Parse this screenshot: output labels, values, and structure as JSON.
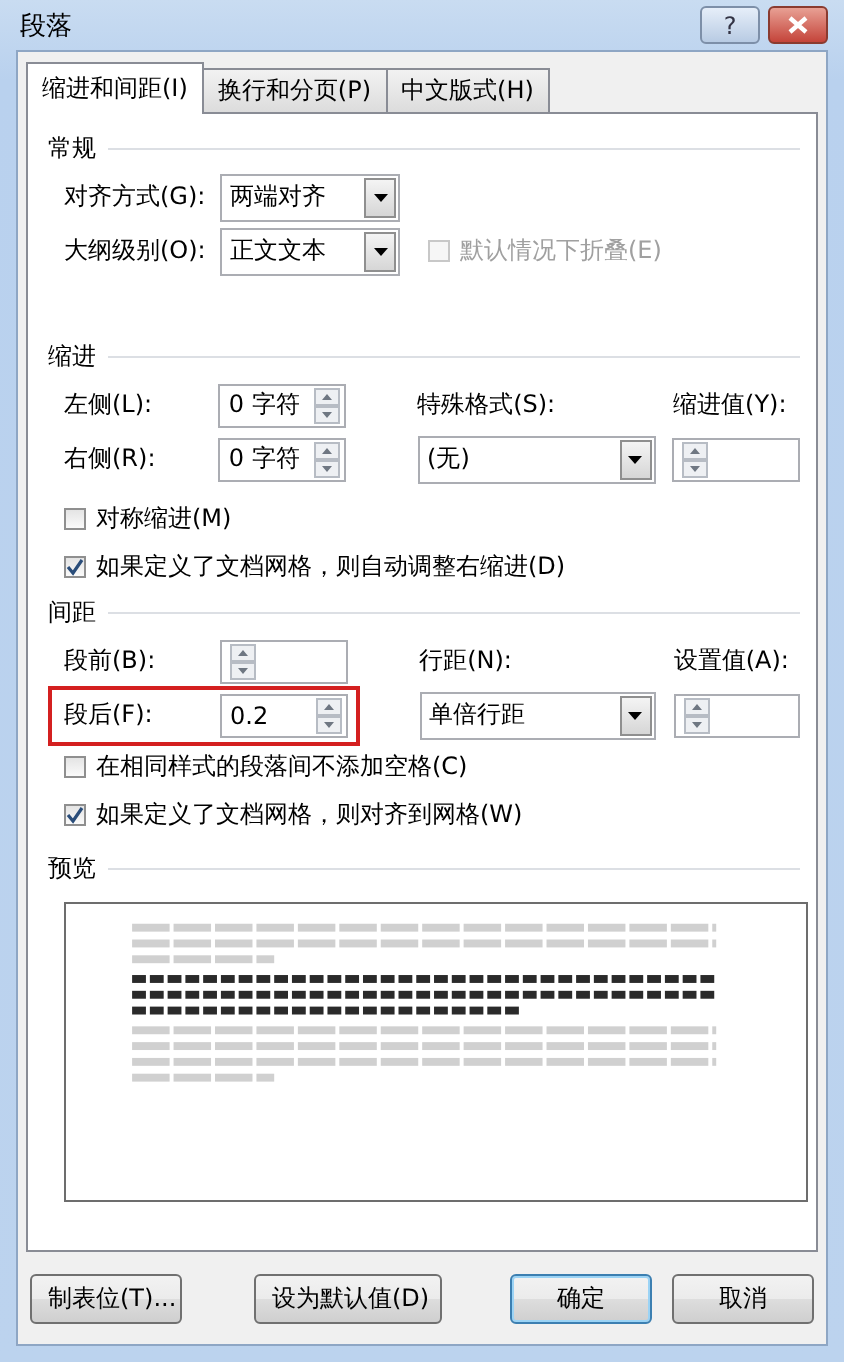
{
  "window": {
    "title": "段落",
    "help_button": "?"
  },
  "tabs": [
    {
      "label": "缩进和间距(I)",
      "selected": true
    },
    {
      "label": "换行和分页(P)",
      "selected": false
    },
    {
      "label": "中文版式(H)",
      "selected": false
    }
  ],
  "general": {
    "heading": "常规",
    "alignment": {
      "label": "对齐方式(G):",
      "value": "两端对齐"
    },
    "outline_level": {
      "label": "大纲级别(O):",
      "value": "正文文本"
    },
    "collapse": {
      "label": "默认情况下折叠(E)",
      "checked": false,
      "disabled": true
    }
  },
  "indent": {
    "heading": "缩进",
    "left": {
      "label": "左侧(L):",
      "value": "0 字符"
    },
    "right": {
      "label": "右侧(R):",
      "value": "0 字符"
    },
    "special": {
      "label": "特殊格式(S):",
      "value": "(无)"
    },
    "by": {
      "label": "缩进值(Y):"
    },
    "mirror": {
      "label": "对称缩进(M)",
      "checked": false,
      "disabled": false
    },
    "auto_adjust": {
      "label": "如果定义了文档网格，则自动调整右缩进(D)",
      "checked": true,
      "disabled": false
    }
  },
  "spacing": {
    "heading": "间距",
    "before": {
      "label": "段前(B):",
      "highlighted": false
    },
    "after": {
      "label": "段后(F):",
      "value": "0.2",
      "highlighted": true
    },
    "line_spacing": {
      "label": "行距(N):",
      "value": "单倍行距"
    },
    "at": {
      "label": "设置值(A):"
    },
    "no_space": {
      "label": "在相同样式的段落间不添加空格(C)",
      "checked": false,
      "disabled": false
    },
    "snap": {
      "label": "如果定义了文档网格，则对齐到网格(W)",
      "checked": true,
      "disabled": false
    }
  },
  "preview": {
    "heading": "预览"
  },
  "buttons": [
    {
      "label": "制表位(T)...",
      "default": false
    },
    {
      "label": "设为默认值(D)",
      "default": false
    },
    {
      "label": "确定",
      "default": true
    },
    {
      "label": "取消",
      "default": false
    }
  ]
}
